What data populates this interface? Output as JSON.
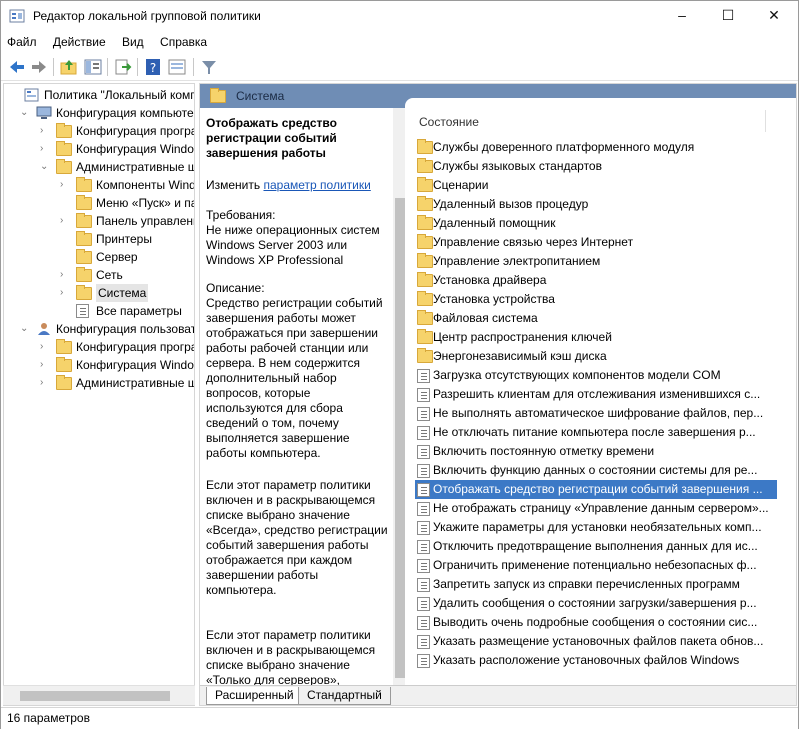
{
  "window": {
    "title": "Редактор локальной групповой политики",
    "controls": [
      "–",
      "☐",
      "✕"
    ]
  },
  "menu": [
    "Файл",
    "Действие",
    "Вид",
    "Справка"
  ],
  "tree": {
    "items": [
      {
        "label": "Политика \"Локальный компь",
        "level": 0,
        "arrow": "",
        "icon": "policy"
      },
      {
        "label": "Конфигурация компьютер",
        "level": 1,
        "arrow": "⌄",
        "icon": "computer"
      },
      {
        "label": "Конфигурация програм",
        "level": 2,
        "arrow": "›",
        "icon": "folder"
      },
      {
        "label": "Конфигурация Window",
        "level": 2,
        "arrow": "›",
        "icon": "folder"
      },
      {
        "label": "Административные ша",
        "level": 2,
        "arrow": "⌄",
        "icon": "folder"
      },
      {
        "label": "Компоненты Windo",
        "level": 3,
        "arrow": "›",
        "icon": "folder"
      },
      {
        "label": "Меню «Пуск» и пане",
        "level": 3,
        "arrow": "",
        "icon": "folder"
      },
      {
        "label": "Панель управления",
        "level": 3,
        "arrow": "›",
        "icon": "folder"
      },
      {
        "label": "Принтеры",
        "level": 3,
        "arrow": "",
        "icon": "folder"
      },
      {
        "label": "Сервер",
        "level": 3,
        "arrow": "",
        "icon": "folder"
      },
      {
        "label": "Сеть",
        "level": 3,
        "arrow": "›",
        "icon": "folder"
      },
      {
        "label": "Система",
        "level": 3,
        "arrow": "›",
        "icon": "folder",
        "selected": true
      },
      {
        "label": "Все параметры",
        "level": 3,
        "arrow": "",
        "icon": "settings"
      },
      {
        "label": "Конфигурация пользовате",
        "level": 1,
        "arrow": "⌄",
        "icon": "user"
      },
      {
        "label": "Конфигурация програм",
        "level": 2,
        "arrow": "›",
        "icon": "folder"
      },
      {
        "label": "Конфигурация Window",
        "level": 2,
        "arrow": "›",
        "icon": "folder"
      },
      {
        "label": "Административные ша",
        "level": 2,
        "arrow": "›",
        "icon": "folder"
      }
    ]
  },
  "pathbar": {
    "title": "Система"
  },
  "description": {
    "heading": "Отображать средство регистрации событий завершения работы",
    "edit_prefix": "Изменить",
    "edit_link": "параметр политики",
    "requirements": "Требования:\nНе ниже операционных систем Windows Server 2003 или Windows XP Professional",
    "description_title": "Описание:",
    "description_text": "Средство регистрации событий завершения работы может отображаться при завершении работы рабочей станции или сервера.  В нем содержится дополнительный набор вопросов, которые используются для сбора сведений о том, почему выполняется завершение работы компьютера.",
    "para2": "Если этот параметр политики включен и в раскрывающемся списке выбрано значение «Всегда», средство регистрации событий завершения работы отображается при каждом завершении работы компьютера.",
    "para3": "Если этот параметр политики включен и в раскрывающемся списке выбрано значение «Только для серверов», средство"
  },
  "list": {
    "column_header": "Состояние",
    "items": [
      {
        "label": "Службы доверенного платформенного модуля",
        "type": "folder"
      },
      {
        "label": "Службы языковых стандартов",
        "type": "folder"
      },
      {
        "label": "Сценарии",
        "type": "folder"
      },
      {
        "label": "Удаленный вызов процедур",
        "type": "folder"
      },
      {
        "label": "Удаленный помощник",
        "type": "folder"
      },
      {
        "label": "Управление связью через Интернет",
        "type": "folder"
      },
      {
        "label": "Управление электропитанием",
        "type": "folder"
      },
      {
        "label": "Установка драйвера",
        "type": "folder"
      },
      {
        "label": "Установка устройства",
        "type": "folder"
      },
      {
        "label": "Файловая система",
        "type": "folder"
      },
      {
        "label": "Центр распространения ключей",
        "type": "folder"
      },
      {
        "label": "Энергонезависимый кэш диска",
        "type": "folder"
      },
      {
        "label": "Загрузка отсутствующих компонентов модели COM",
        "type": "policy"
      },
      {
        "label": "Разрешить клиентам для отслеживания изменившихся с...",
        "type": "policy"
      },
      {
        "label": "Не выполнять автоматическое шифрование файлов, пер...",
        "type": "policy"
      },
      {
        "label": "Не отключать питание компьютера после завершения р...",
        "type": "policy"
      },
      {
        "label": "Включить постоянную отметку времени",
        "type": "policy"
      },
      {
        "label": "Включить функцию данных о состоянии системы для ре...",
        "type": "policy"
      },
      {
        "label": "Отображать средство регистрации событий завершения ...",
        "type": "policy",
        "selected": true
      },
      {
        "label": "Не отображать страницу «Управление данным сервером»...",
        "type": "policy"
      },
      {
        "label": "Укажите параметры для установки необязательных комп...",
        "type": "policy"
      },
      {
        "label": "Отключить предотвращение выполнения данных для ис...",
        "type": "policy"
      },
      {
        "label": "Ограничить применение потенциально небезопасных ф...",
        "type": "policy"
      },
      {
        "label": "Запретить запуск из справки перечисленных программ",
        "type": "policy"
      },
      {
        "label": "Удалить сообщения о состоянии загрузки/завершения р...",
        "type": "policy"
      },
      {
        "label": "Выводить очень подробные сообщения о состоянии сис...",
        "type": "policy"
      },
      {
        "label": "Указать размещение установочных файлов пакета обнов...",
        "type": "policy"
      },
      {
        "label": "Указать расположение установочных файлов Windows",
        "type": "policy"
      }
    ]
  },
  "tabs": [
    "Расширенный",
    "Стандартный"
  ],
  "status": "16 параметров",
  "colors": {
    "selection": "#3c79c6",
    "pathbar": "#6f8db5",
    "folder": "#f6d36b",
    "link": "#1a57b7"
  }
}
